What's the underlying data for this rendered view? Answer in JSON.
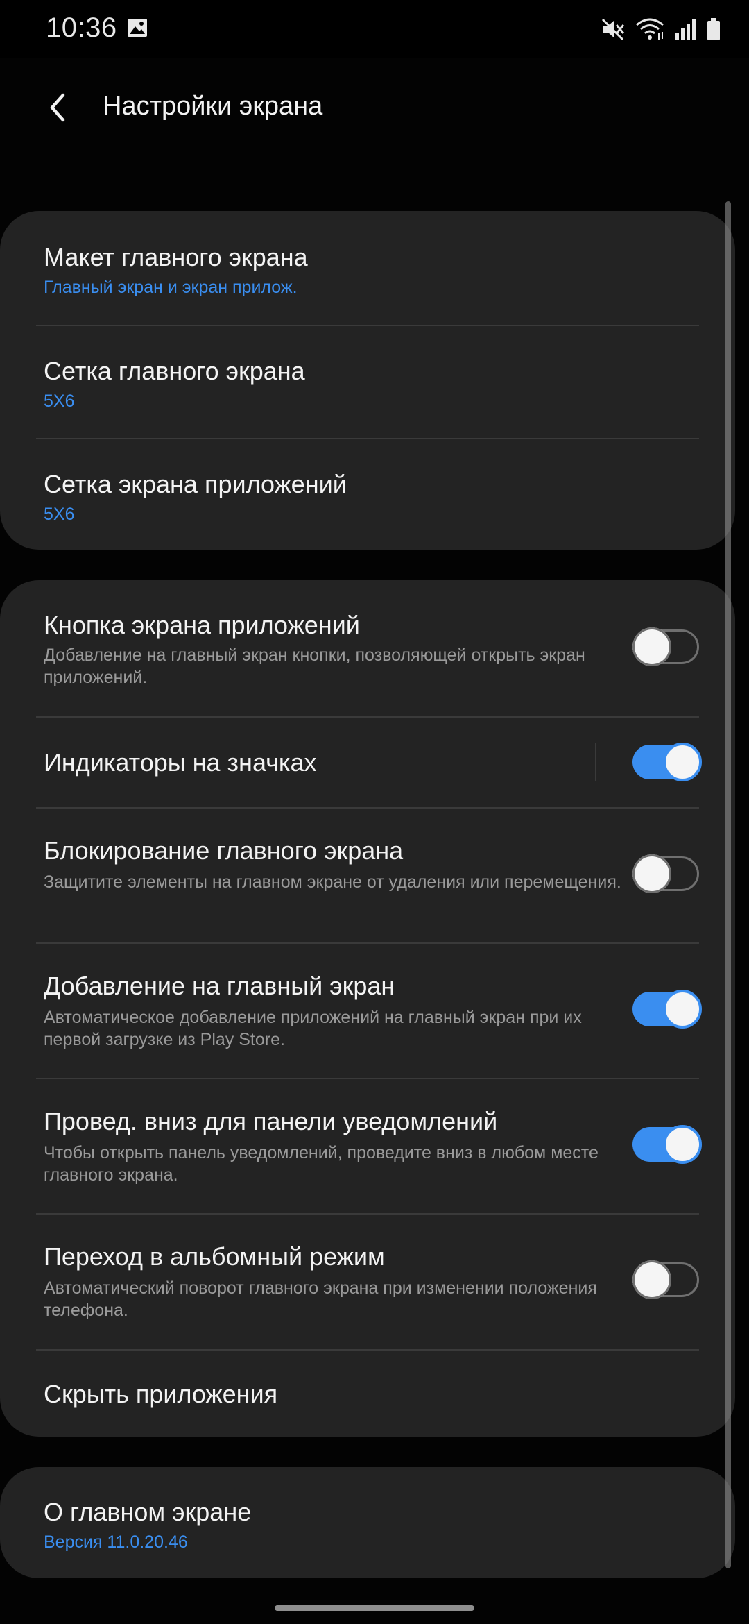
{
  "status_bar": {
    "time": "10:36",
    "left_icons": [
      "gallery-icon"
    ],
    "right_icons": [
      "mute-icon",
      "wifi-icon",
      "signal-icon",
      "battery-icon"
    ]
  },
  "header": {
    "title": "Настройки экрана",
    "back_icon": "back-arrow-icon"
  },
  "card1": {
    "items": [
      {
        "title": "Макет главного экрана",
        "value": "Главный экран и экран прилож."
      },
      {
        "title": "Сетка главного экрана",
        "value": "5X6"
      },
      {
        "title": "Сетка экрана приложений",
        "value": "5X6"
      }
    ]
  },
  "card2": {
    "items": [
      {
        "title": "Кнопка экрана приложений",
        "description": "Добавление на главный экран кнопки, позволяющей открыть экран приложений.",
        "toggle": false
      },
      {
        "title": "Индикаторы на значках",
        "toggle": true
      },
      {
        "title": "Блокирование главного экрана",
        "description": "Защитите элементы на главном экране от удаления или перемещения.",
        "toggle": false
      },
      {
        "title": "Добавление на главный экран",
        "description": "Автоматическое добавление приложений на главный экран при их первой загрузке из Play Store.",
        "toggle": true
      },
      {
        "title": "Провед. вниз для панели уведомлений",
        "description": "Чтобы открыть панель уведомлений, проведите вниз в любом месте главного экрана.",
        "toggle": true
      },
      {
        "title": "Переход в альбомный режим",
        "description": "Автоматический поворот главного экрана при изменении положения телефона.",
        "toggle": false
      },
      {
        "title": "Скрыть приложения"
      }
    ]
  },
  "card3": {
    "items": [
      {
        "title": "О главном экране",
        "value": "Версия 11.0.20.46"
      }
    ]
  },
  "colors": {
    "accent": "#3a8ef0",
    "background": "#030303",
    "card": "#232323",
    "divider": "#3a3a3a"
  }
}
